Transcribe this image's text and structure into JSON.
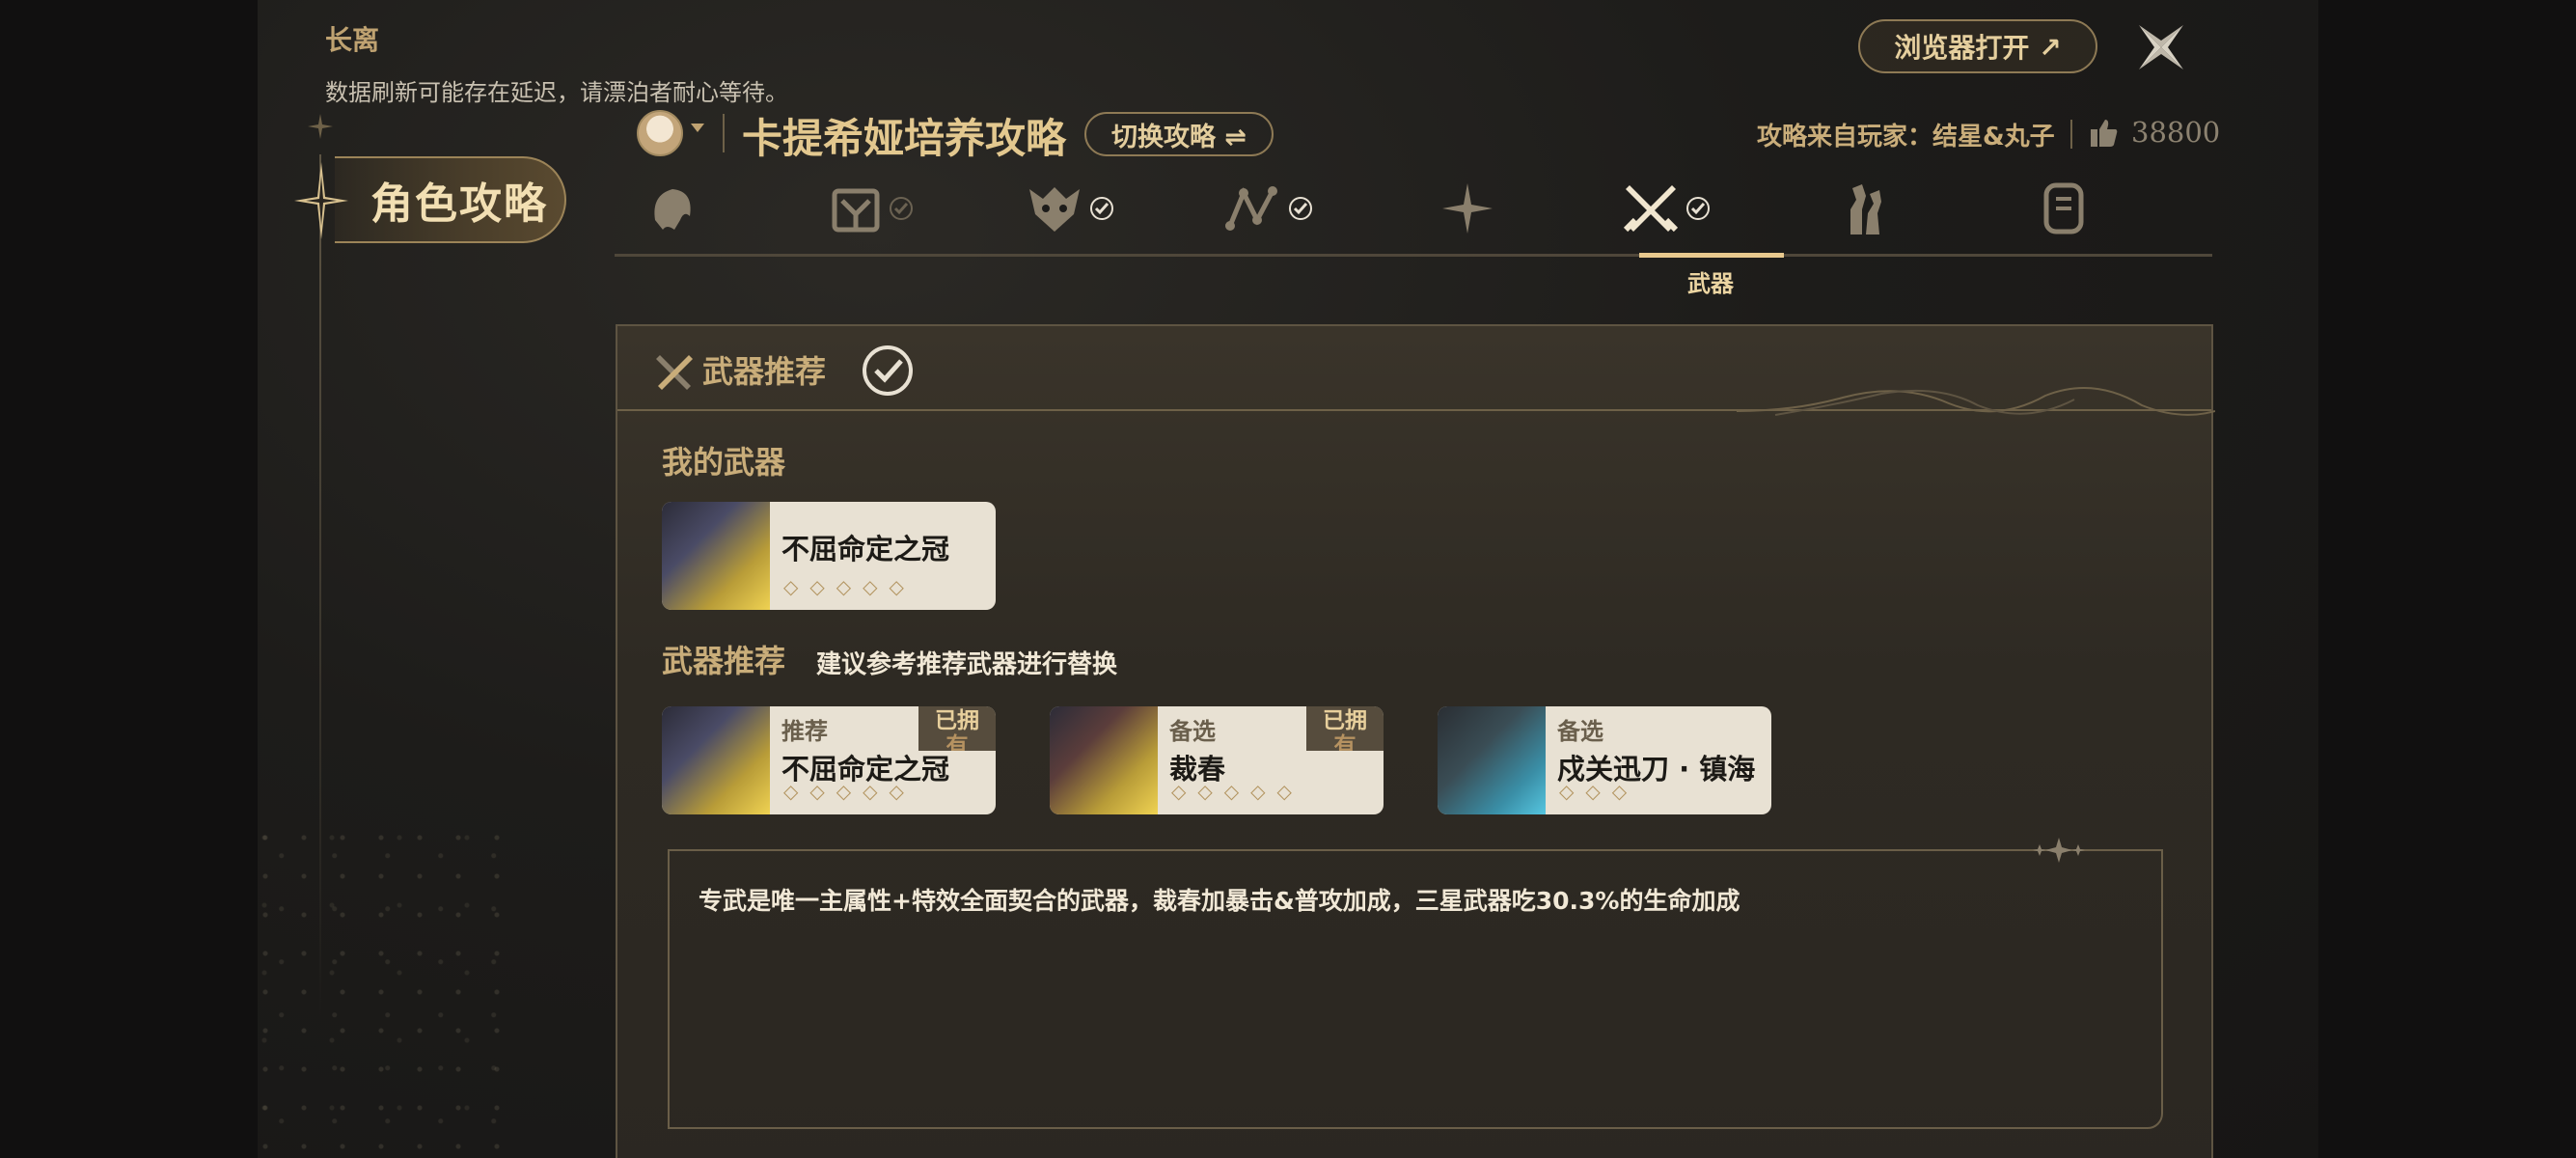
{
  "window": {
    "app_title": "长离",
    "notice": "数据刷新可能存在延迟，请漂泊者耐心等待。",
    "browser_button": "浏览器打开 ↗"
  },
  "sidebar": {
    "active_tab": "角色攻略"
  },
  "header": {
    "guide_title": "卡提希娅培养攻略",
    "switch_button": "切换攻略 ⇌",
    "source": "攻略来自玩家：结星&丸子",
    "likes": "38800"
  },
  "tabs": {
    "items": [
      {
        "icon": "character-head-icon",
        "checked": false
      },
      {
        "icon": "resonance-chain-icon",
        "checked": true
      },
      {
        "icon": "echo-mask-icon",
        "checked": true
      },
      {
        "icon": "skill-tree-icon",
        "checked": true
      },
      {
        "icon": "sparkle-star-icon",
        "checked": false
      },
      {
        "icon": "crossed-swords-icon",
        "checked": true,
        "active": true
      },
      {
        "icon": "team-figures-icon",
        "checked": false
      },
      {
        "icon": "document-icon",
        "checked": false
      }
    ],
    "active_label": "武器"
  },
  "panel": {
    "title": "武器推荐",
    "my_weapon_title": "我的武器",
    "my_weapon": {
      "name": "不屈命定之冠",
      "stars": "◇◇◇◇◇"
    },
    "recommend_title": "武器推荐",
    "recommend_sub": "建议参考推荐武器进行替换",
    "recommendations": [
      {
        "tag": "推荐",
        "name": "不屈命定之冠",
        "stars": "◇◇◇◇◇",
        "owned_1": "已拥",
        "owned_2": "有"
      },
      {
        "tag": "备选",
        "name": "裁春",
        "stars": "◇◇◇◇◇",
        "owned_1": "已拥",
        "owned_2": "有"
      },
      {
        "tag": "备选",
        "name": "戍关迅刀 · 镇海",
        "stars": "◇◇◇"
      }
    ],
    "note": "专武是唯一主属性+特效全面契合的武器，裁春加暴击&普攻加成，三星武器吃30.3%的生命加成"
  },
  "colors": {
    "accent": "#c9ad7a",
    "bg": "#1d1c1a",
    "card": "#e8e1d3"
  }
}
